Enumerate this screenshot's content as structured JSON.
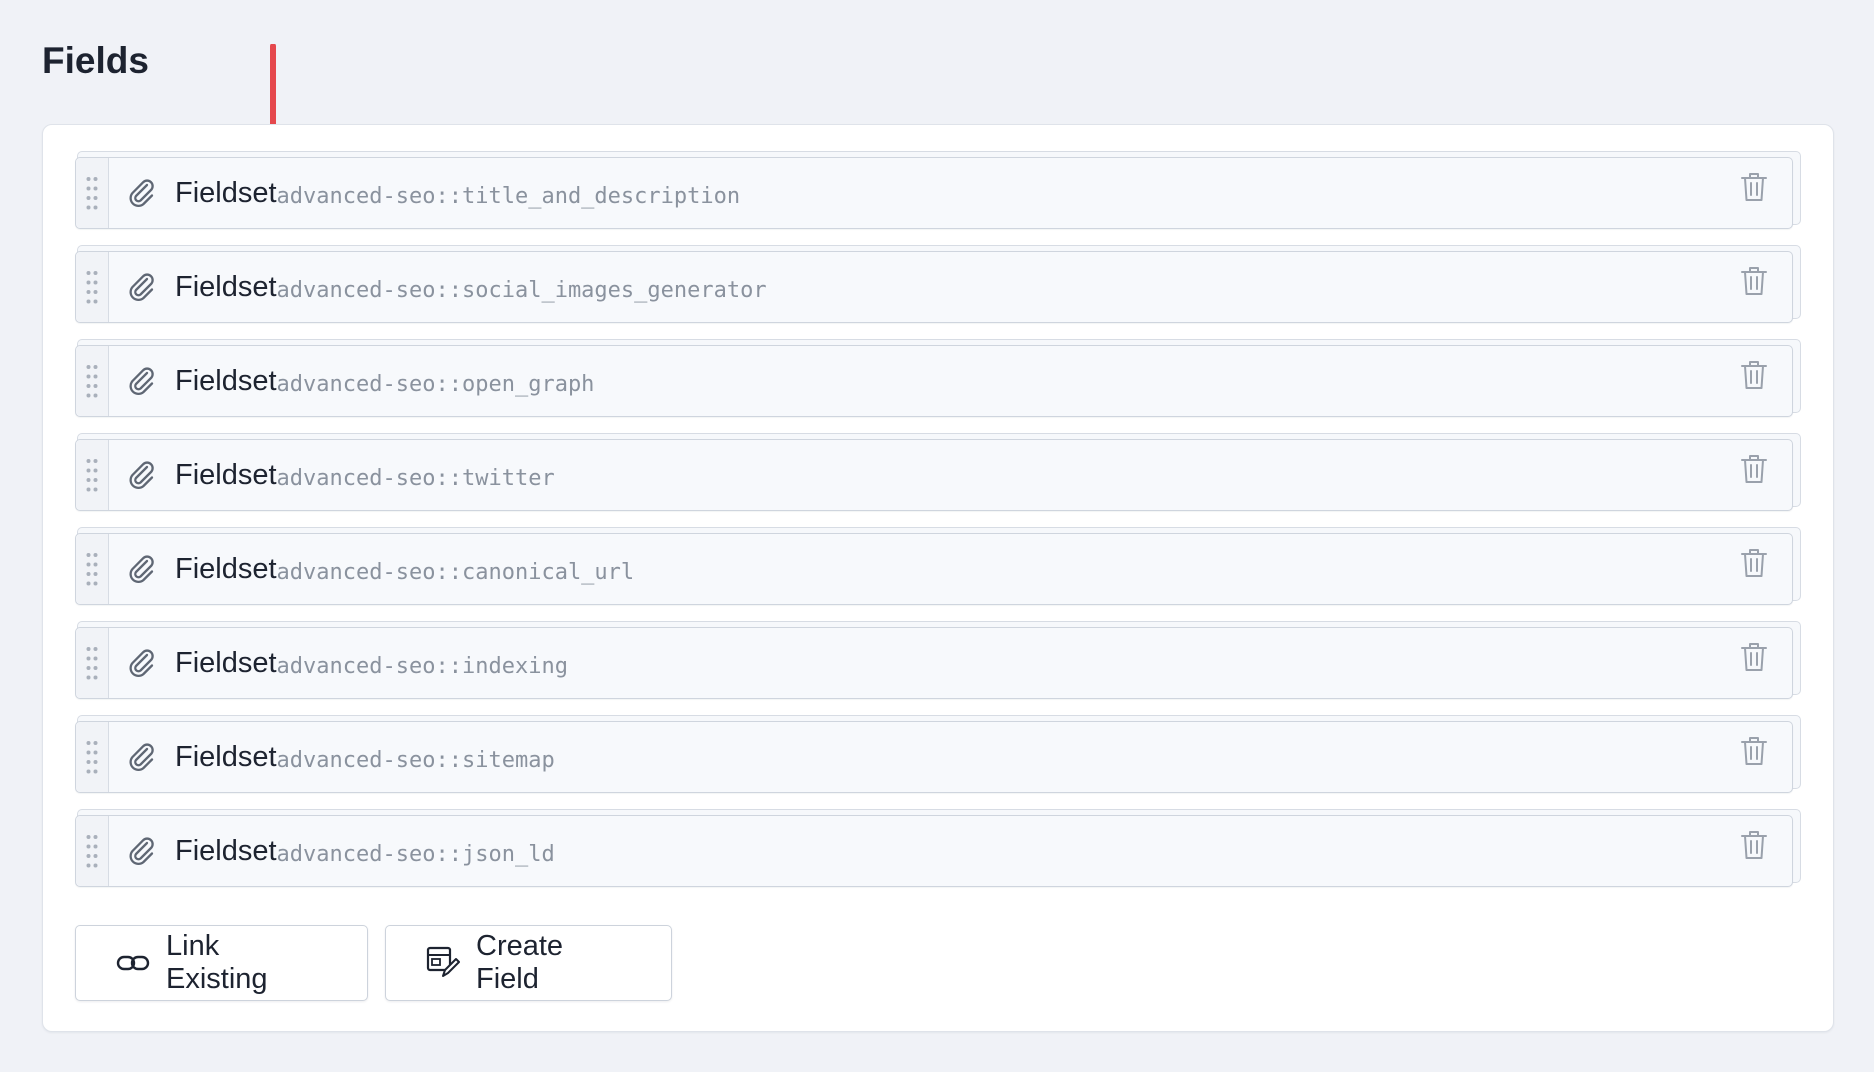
{
  "page": {
    "title": "Fields"
  },
  "fields": [
    {
      "label": "Fieldset",
      "handle": "advanced-seo::title_and_description"
    },
    {
      "label": "Fieldset",
      "handle": "advanced-seo::social_images_generator"
    },
    {
      "label": "Fieldset",
      "handle": "advanced-seo::open_graph"
    },
    {
      "label": "Fieldset",
      "handle": "advanced-seo::twitter"
    },
    {
      "label": "Fieldset",
      "handle": "advanced-seo::canonical_url"
    },
    {
      "label": "Fieldset",
      "handle": "advanced-seo::indexing"
    },
    {
      "label": "Fieldset",
      "handle": "advanced-seo::sitemap"
    },
    {
      "label": "Fieldset",
      "handle": "advanced-seo::json_ld"
    }
  ],
  "actions": {
    "link_existing_label": "Link Existing",
    "create_field_label": "Create Field"
  },
  "icons": {
    "row_icon": "paperclip-icon",
    "drag": "drag-handle-icon",
    "delete": "trash-icon",
    "link": "link-icon",
    "create": "create-field-icon",
    "annotation": "red-arrow-icon"
  },
  "colors": {
    "background": "#f0f2f7",
    "text": "#1d2330",
    "muted": "#8a929e",
    "arrow": "#e5484d"
  }
}
